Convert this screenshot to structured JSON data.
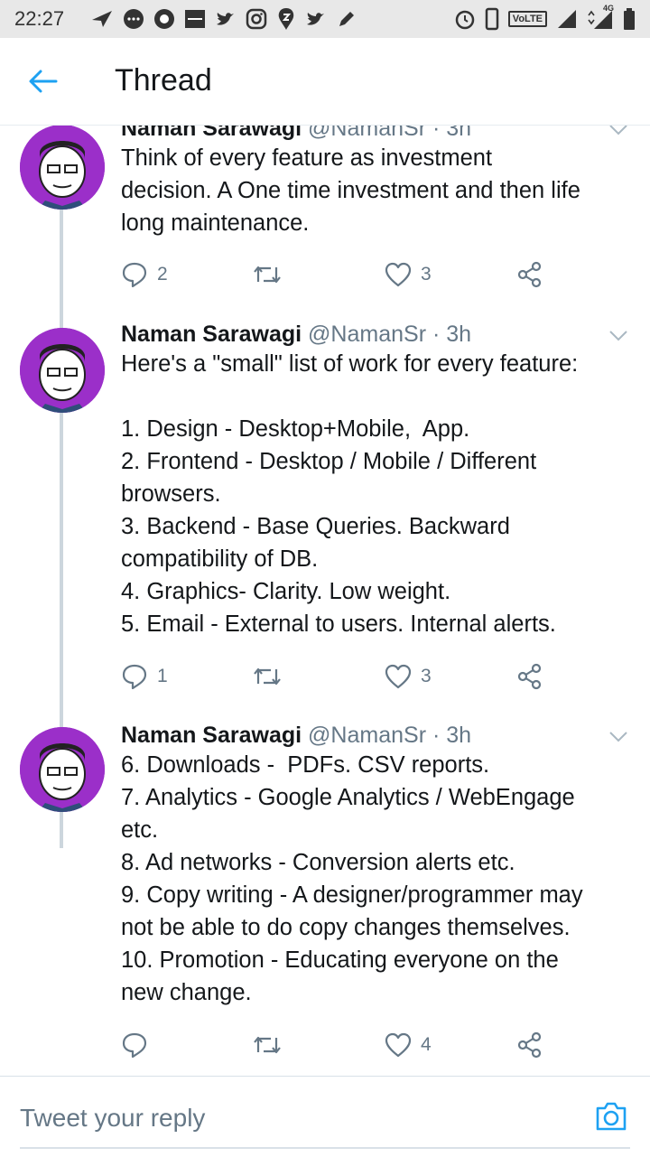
{
  "status_bar": {
    "time": "22:27",
    "network_label": "VoLTE",
    "network_type": "4G",
    "left_icons": [
      "send-icon",
      "messages-icon",
      "circle-app-icon",
      "zomato-icon",
      "twitter-icon",
      "instagram-icon",
      "swiggy-icon",
      "twitter-icon",
      "pen-icon"
    ],
    "right_icons": [
      "alarm-icon",
      "phone-outline-icon",
      "volte-icon",
      "signal-icon",
      "signal-4g-icon",
      "battery-icon"
    ]
  },
  "header": {
    "title": "Thread",
    "back_icon": "arrow-left-icon"
  },
  "colors": {
    "accent": "#1da1f2",
    "text": "#14171a",
    "muted": "#657786",
    "avatar_bg": "#9b2fc9",
    "divider": "#e6ecf0"
  },
  "tweets": [
    {
      "name": "Naman Sarawagi",
      "handle": "@NamanSr",
      "time": "3h",
      "text": "Think of every feature as investment\ndecision. A One time investment and then life\nlong maintenance.",
      "replies": "2",
      "likes": "3"
    },
    {
      "name": "Naman Sarawagi",
      "handle": "@NamanSr",
      "time": "3h",
      "text": "Here's a \"small\" list of work for every feature:\n\n1. Design - Desktop+Mobile,  App.\n2. Frontend - Desktop / Mobile / Different\nbrowsers.\n3. Backend - Base Queries. Backward\ncompatibility of DB.\n4. Graphics- Clarity. Low weight.\n5. Email - External to users. Internal alerts.",
      "replies": "1",
      "likes": "3"
    },
    {
      "name": "Naman Sarawagi",
      "handle": "@NamanSr",
      "time": "3h",
      "text": "6. Downloads -  PDFs. CSV reports.\n7. Analytics - Google Analytics / WebEngage\netc.\n8. Ad networks - Conversion alerts etc.\n9. Copy writing - A designer/programmer may\nnot be able to do copy changes themselves.\n10. Promotion - Educating everyone on the\nnew change.",
      "replies": "",
      "likes": "4"
    }
  ],
  "reply_bar": {
    "placeholder": "Tweet your reply",
    "camera_icon": "camera-icon"
  }
}
